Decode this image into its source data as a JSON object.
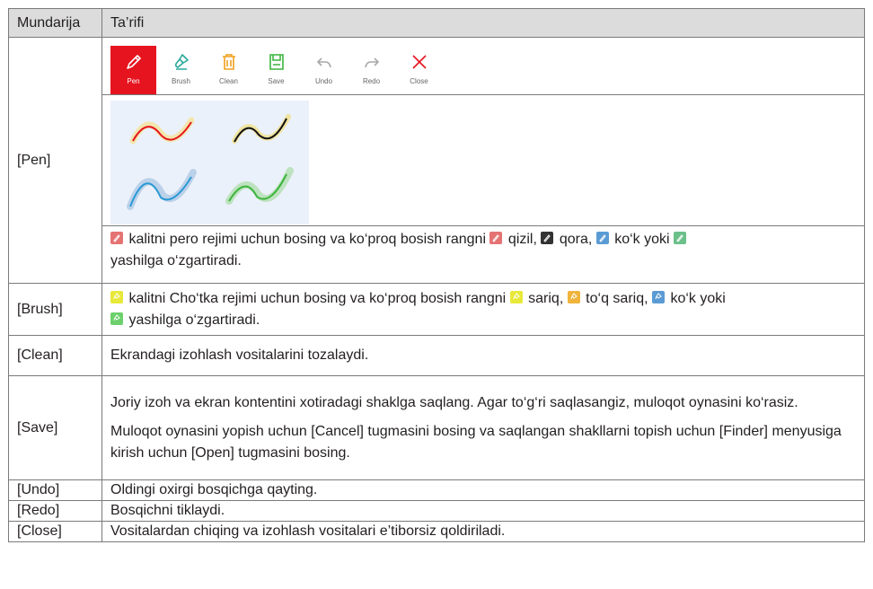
{
  "table": {
    "header": {
      "col1": "Mundarija",
      "col2": "Ta’rifi"
    },
    "toolbar": [
      {
        "label": "Pen",
        "icon": "pen-icon",
        "selected": true
      },
      {
        "label": "Brush",
        "icon": "brush-icon"
      },
      {
        "label": "Clean",
        "icon": "trash-icon"
      },
      {
        "label": "Save",
        "icon": "save-icon"
      },
      {
        "label": "Undo",
        "icon": "undo-icon"
      },
      {
        "label": "Redo",
        "icon": "redo-icon"
      },
      {
        "label": "Close",
        "icon": "close-icon"
      }
    ],
    "colors": {
      "accent_red": "#e6141e",
      "icon_teal": "#2aa89a",
      "icon_orange": "#f0a01e",
      "icon_green": "#3cb43c",
      "grey": "#a9a9a9"
    },
    "swatch_label_pen": "Pen",
    "swatch_label_brush": "Brush",
    "rows": {
      "pen": {
        "name": "[Pen]",
        "t1": "kalitni pero rejimi uchun bosing va ko‘proq bosish rangni",
        "t2": "qizil,",
        "t3": "qora,",
        "t4": "ko‘k yoki",
        "t5": "yashilga o‘zgartiradi."
      },
      "brush": {
        "name": "[Brush]",
        "t1": "kalitni Cho‘tka rejimi uchun bosing va ko‘proq bosish rangni",
        "t2": "sariq,",
        "t3": "to‘q sariq,",
        "t4": "ko‘k yoki",
        "t5": "yashilga o‘zgartiradi."
      },
      "clean": {
        "name": "[Clean]",
        "desc": "Ekrandagi izohlash vositalarini tozalaydi."
      },
      "save": {
        "name": "[Save]",
        "p1": "Joriy izoh va ekran kontentini xotiradagi shaklga saqlang. Agar to‘g‘ri saqlasangiz, muloqot oynasini ko‘rasiz.",
        "p2": "Muloqot oynasini yopish uchun [Cancel] tugmasini bosing va saqlangan shakllarni topish uchun [Finder] menyusiga kirish uchun [Open] tugmasini bosing."
      },
      "undo": {
        "name": "[Undo]",
        "desc": "Oldingi oxirgi bosqichga qayting."
      },
      "redo": {
        "name": "[Redo]",
        "desc": "Bosqichni tiklaydi."
      },
      "close": {
        "name": "[Close]",
        "desc": "Vositalardan chiqing va izohlash vositalari e’tiborsiz qoldiriladi."
      }
    }
  }
}
